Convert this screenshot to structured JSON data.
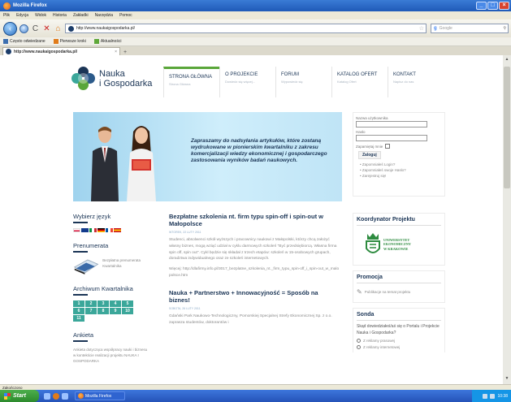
{
  "window": {
    "title": "Mozilla Firefox",
    "controls": {
      "minimize": "_",
      "maximize": "□",
      "close": "×"
    }
  },
  "menu": [
    "Plik",
    "Edycja",
    "Widok",
    "Historia",
    "Zakładki",
    "Narzędzia",
    "Pomoc"
  ],
  "nav": {
    "back": "‹",
    "forward": "›",
    "reload": "C",
    "stop": "✕",
    "home": "⌂",
    "url": "http://www.naukaigospodarka.pl/",
    "search_placeholder": "Google"
  },
  "bookmarks": [
    "Często odwiedzane",
    "Pierwsze kroki",
    "Aktualności"
  ],
  "tab": {
    "label": "http://www.naukaigospodarka.pl/",
    "close": "×",
    "new_tab": "+"
  },
  "site": {
    "logo_line1": "Nauka",
    "logo_line2": "i Gospodarka",
    "topnav": [
      {
        "title": "STRONA GŁÓWNA",
        "sub": "Strona Główna"
      },
      {
        "title": "O PROJEKCIE",
        "sub": "Dowiedz się więcej..."
      },
      {
        "title": "FORUM",
        "sub": "Wypowiedz się"
      },
      {
        "title": "KATALOG OFERT",
        "sub": "Katalog Ofert"
      },
      {
        "title": "KONTAKT",
        "sub": "Napisz do nas"
      }
    ],
    "hero_text": "Zapraszamy do nadsyłania artykułów, które zostaną wydrukowane w pionierskim kwartalniku z zakresu komercjalizacji wiedzy ekonomicznej i gospodarczego zastosowania wyników badań naukowych."
  },
  "login": {
    "username_label": "Nazwa użytkownika",
    "password_label": "Hasło",
    "remember_label": "Zapamiętaj mnie",
    "button": "Zaloguj",
    "links": [
      "Zapomniałeś Login?",
      "Zapomniałeś swoje Hasło?",
      "Zarejestruj się!"
    ]
  },
  "left": {
    "lang_head": "Wybierz język",
    "newsletter_head": "Prenumerata",
    "newsletter_text": "Bezpłatna prenumerata Kwartalnika",
    "archive_head": "Archiwum Kwartalnika",
    "archive_cells": [
      "1",
      "2",
      "3",
      "4",
      "5",
      "6",
      "7",
      "8",
      "9",
      "10",
      "11"
    ],
    "poll_head": "Ankieta",
    "poll_text": "Ankieta dotycząca współpracy nauki i biznesu w kontekście realizacji projektu NAUKA I GOSPODARKA"
  },
  "articles": [
    {
      "title": "Bezpłatne szkolenia nt. firm typu spin-off i spin-out w Małopolsce",
      "date": "WTOREK, 22 LUTY 2011",
      "body": "Studenci, absolwenci szkół wyższych i pracownicy naukowi z Małopolski, którzy chcą założyć własny biznes, mogą wziąć udział w cyklu darmowych szkoleń \"Być przedsiębiorcą. Własna firma spin off, spin out\". Cykl będzie się składał z trzech etapów: szkoleń w 15-osobowych grupach, doradztwa indywidualnego oraz ze szkoleń internetowych.",
      "more": "Więcej: http://dlafirmy.info.pl/3017_bezplatne_szkolenia_nt._firm_typu_spin-off_i_spin-out_w_malopolsce.htm"
    },
    {
      "title": "Nauka + Partnerstwo + Innowacyjność = Sposób na biznes!",
      "date": "SOBOTA, 26 LUTY 2011",
      "body": "Gdański Park Naukowo-Technologiczny, Pomorskiej Specjalnej Strefy Ekonomicznej Sp. z o.o. zaprasza studentów, doktorantów i"
    }
  ],
  "right": {
    "coordinator_head": "Koordynator Projektu",
    "uek_line1": "UNIWERSYTET",
    "uek_line2": "EKONOMICZNY",
    "uek_line3": "W KRAKOWIE",
    "promo_head": "Promocja",
    "promo_text": "Publikacje na temat projektu",
    "poll_head": "Sonda",
    "poll_question": "Skąd dowiedziałeś/aś się o Portalu i Projekcie Nauka i Gospodarka?",
    "poll_options": [
      "Z reklamy prasowej",
      "Z reklamy internetowej"
    ]
  },
  "status": "Zakończono",
  "taskbar": {
    "start": "Start",
    "task": "Mozilla Firefox",
    "clock": "10:38"
  },
  "colors": {
    "brand": "#1b3556",
    "accent": "#5aa63a",
    "teal": "#3ba79a"
  }
}
